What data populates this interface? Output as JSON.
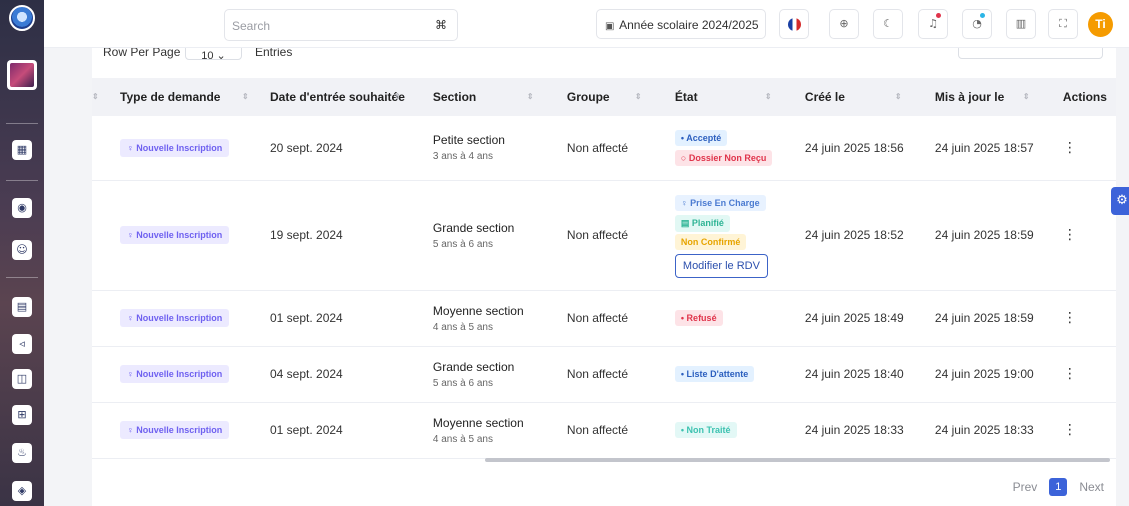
{
  "topbar": {
    "search_placeholder": "Search",
    "school_year": "Année scolaire 2024/2025",
    "user_initials": "Ti"
  },
  "list": {
    "rows_per_page_label": "Row Per Page",
    "rows_per_page_value": "10",
    "entries_label": "Entries"
  },
  "table": {
    "headers": [
      "Type de demande",
      "Date d'entrée souhaitée",
      "Section",
      "Groupe",
      "État",
      "Créé le",
      "Mis à jour le",
      "Actions"
    ],
    "rows": [
      {
        "type": "Nouvelle Inscription",
        "date": "20 sept. 2024",
        "section": "Petite section",
        "ages": "3 ans à 4 ans",
        "groupe": "Non affecté",
        "etat": [
          "• Accepté",
          "○ Dossier Non Reçu"
        ],
        "cree": "24 juin 2025 18:56",
        "maj": "24 juin 2025 18:57"
      },
      {
        "type": "Nouvelle Inscription",
        "date": "19 sept. 2024",
        "section": "Grande section",
        "ages": "5 ans à 6 ans",
        "groupe": "Non affecté",
        "etat": [
          "♀ Prise En Charge",
          "▤ Planifié",
          "Non Confirmé"
        ],
        "action_button": "Modifier le RDV",
        "cree": "24 juin 2025 18:52",
        "maj": "24 juin 2025 18:59"
      },
      {
        "type": "Nouvelle Inscription",
        "date": "01 sept. 2024",
        "section": "Moyenne section",
        "ages": "4 ans à 5 ans",
        "groupe": "Non affecté",
        "etat": [
          "• Refusé"
        ],
        "cree": "24 juin 2025 18:49",
        "maj": "24 juin 2025 18:59"
      },
      {
        "type": "Nouvelle Inscription",
        "date": "04 sept. 2024",
        "section": "Grande section",
        "ages": "5 ans à 6 ans",
        "groupe": "Non affecté",
        "etat": [
          "• Liste D'attente"
        ],
        "cree": "24 juin 2025 18:40",
        "maj": "24 juin 2025 19:00"
      },
      {
        "type": "Nouvelle Inscription",
        "date": "01 sept. 2024",
        "section": "Moyenne section",
        "ages": "4 ans à 5 ans",
        "groupe": "Non affecté",
        "etat": [
          "• Non Traité"
        ],
        "cree": "24 juin 2025 18:33",
        "maj": "24 juin 2025 18:33"
      }
    ]
  },
  "pagination": {
    "prev": "Prev",
    "current": "1",
    "next": "Next"
  },
  "colors": {
    "primary": "#3c63d9",
    "avatar": "#f59b00",
    "notification": "#e0344b"
  }
}
